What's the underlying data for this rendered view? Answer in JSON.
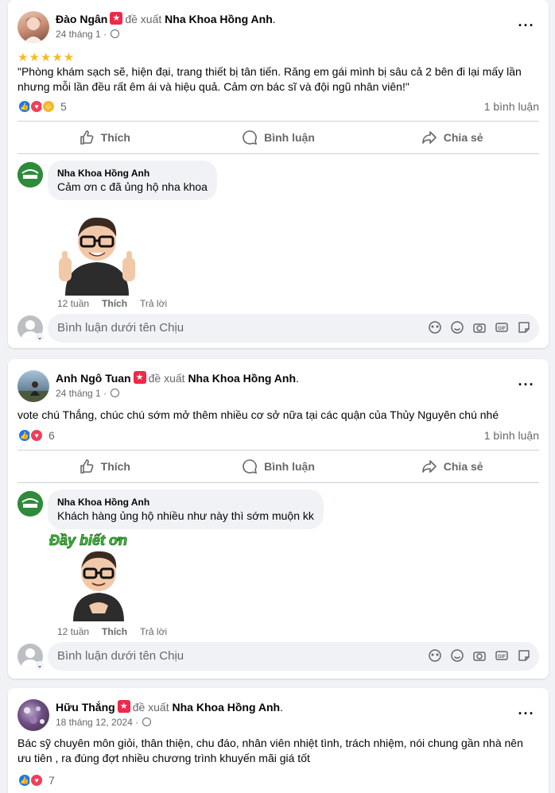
{
  "posts": [
    {
      "author": "Đào Ngân",
      "recommend_text": "đề xuất",
      "page": "Nha Khoa Hồng Anh",
      "date": "24 tháng 1 ·",
      "stars": "★★★★★",
      "text": "\"Phòng khám sạch sẽ, hiện đại, trang thiết bị tân tiến. Răng em gái mình bị sâu cả 2 bên đi lại mấy lần nhưng mỗi lần đều rất êm ái và hiệu quả. Cảm ơn bác sĩ và đội ngũ nhân viên!\"",
      "reaction_count": "5",
      "comment_count": "1 bình luận",
      "comment": {
        "author": "Nha Khoa Hồng Anh",
        "text": "Cảm ơn c đã ủng hộ nha khoa",
        "time": "12 tuần",
        "like": "Thích",
        "reply": "Trả lời"
      }
    },
    {
      "author": "Anh Ngô Tuan",
      "recommend_text": "đề xuất",
      "page": "Nha Khoa Hồng Anh",
      "date": "24 tháng 1 ·",
      "text": "vote chú Thắng, chúc chú sớm mở thêm nhiều cơ sở nữa tại các quận của Thủy Nguyên chú nhé",
      "reaction_count": "6",
      "comment_count": "1 bình luận",
      "comment": {
        "author": "Nha Khoa Hồng Anh",
        "text": "Khách hàng ủng hộ nhiều như này thì sớm muộn kk",
        "sticker_text": "Đầy biết ơn",
        "time": "12 tuần",
        "like": "Thích",
        "reply": "Trả lời"
      }
    },
    {
      "author": "Hữu Thắng",
      "recommend_text": "đề xuất",
      "page": "Nha Khoa Hồng Anh",
      "date": "18 tháng 12, 2024 ·",
      "text": "Bác sỹ chuyên môn giỏi, thân thiện, chu đáo, nhân viên nhiệt tình, trách nhiệm, nói chung gần nhà nên ưu tiên , ra đúng đợt nhiều chương trình khuyến mãi giá tốt",
      "reaction_count": "7"
    }
  ],
  "actions": {
    "like": "Thích",
    "comment": "Bình luận",
    "share": "Chia sẻ"
  },
  "comment_input": {
    "placeholder": "Bình luận dưới tên Chịu"
  },
  "colors": {
    "like": "#1877f2",
    "love": "#f33e58",
    "brand_green": "#2e8b3a"
  }
}
